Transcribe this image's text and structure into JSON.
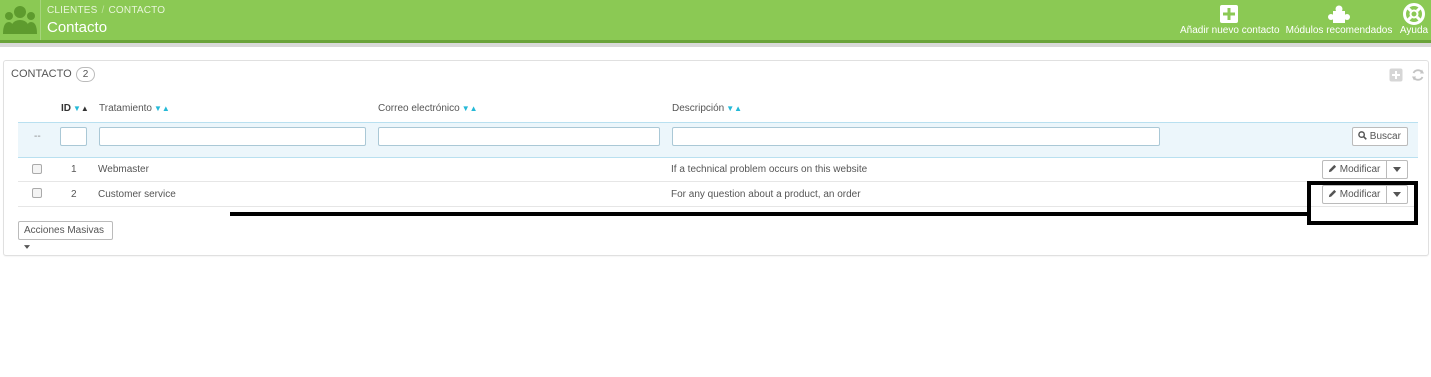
{
  "header": {
    "breadcrumb": [
      "CLIENTES",
      "CONTACTO"
    ],
    "breadcrumb_sep": "/",
    "title": "Contacto",
    "actions": [
      {
        "label": "Añadir nuevo contacto",
        "icon": "plus-square-icon"
      },
      {
        "label": "Módulos recomendados",
        "icon": "puzzle-icon"
      },
      {
        "label": "Ayuda",
        "icon": "help-lifebuoy-icon"
      }
    ]
  },
  "panel": {
    "heading": "CONTACTO",
    "count": "2",
    "icons": [
      "add-icon",
      "refresh-icon"
    ]
  },
  "table": {
    "columns": [
      "ID",
      "Tratamiento",
      "Correo electrónico",
      "Descripción"
    ],
    "filter_placeholder": "--",
    "search_label": "Buscar",
    "rows": [
      {
        "id": "1",
        "title": "Webmaster",
        "email": "",
        "description": "If a technical problem occurs on this website",
        "action": "Modificar"
      },
      {
        "id": "2",
        "title": "Customer service",
        "email": "",
        "description": "For any question about a product, an order",
        "action": "Modificar"
      }
    ],
    "bulk_actions_label": "Acciones Masivas"
  },
  "colors": {
    "brand": "#8bc954",
    "accent": "#25b9d7"
  }
}
